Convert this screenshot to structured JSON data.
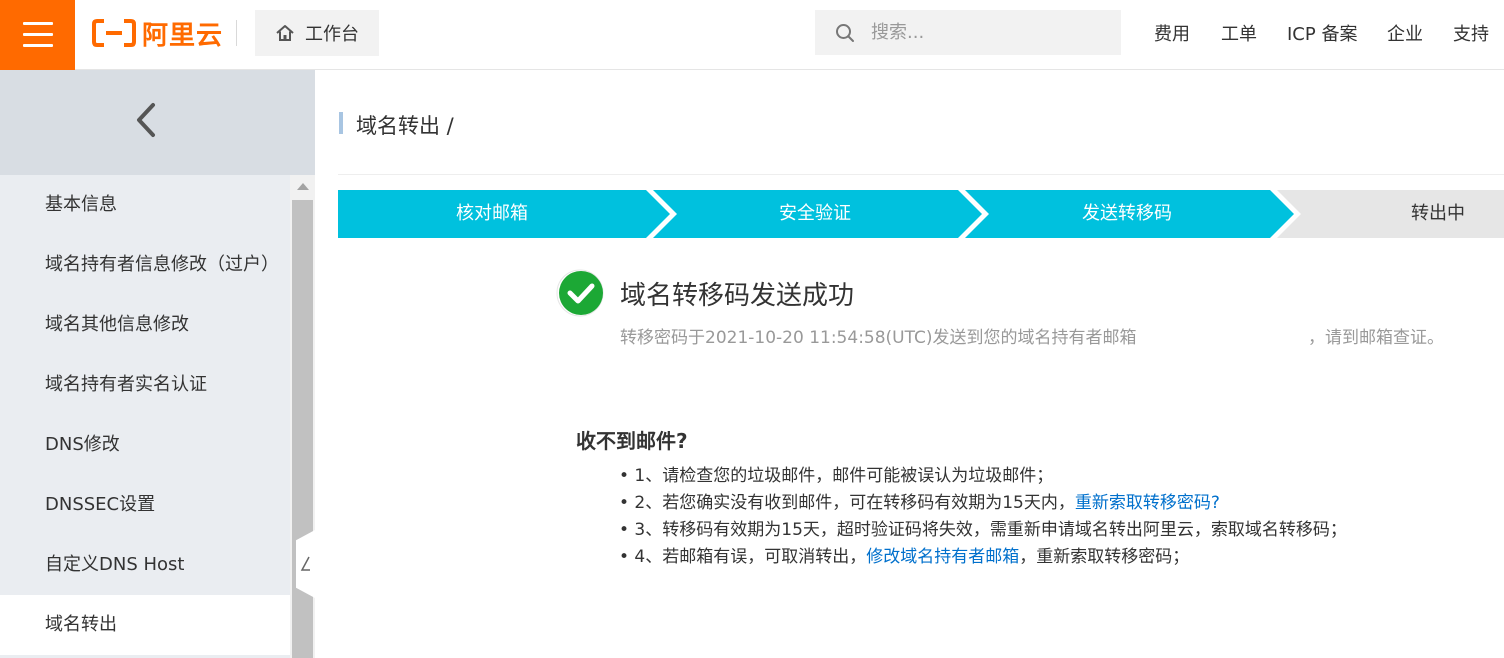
{
  "colors": {
    "brand": "#ff6a00",
    "step_active": "#00c1de",
    "step_inactive": "#e6e6e6",
    "success": "#1ca835",
    "link": "#0070cc"
  },
  "header": {
    "logo_text": "阿里云",
    "workbench_label": "工作台",
    "search_placeholder": "搜索...",
    "nav": [
      "费用",
      "工单",
      "ICP 备案",
      "企业",
      "支持"
    ]
  },
  "sidebar": {
    "items": [
      {
        "label": "基本信息",
        "active": false
      },
      {
        "label": "域名持有者信息修改（过户）",
        "active": false
      },
      {
        "label": "域名其他信息修改",
        "active": false
      },
      {
        "label": "域名持有者实名认证",
        "active": false
      },
      {
        "label": "DNS修改",
        "active": false
      },
      {
        "label": "DNSSEC设置",
        "active": false
      },
      {
        "label": "自定义DNS Host",
        "active": false
      },
      {
        "label": "域名转出",
        "active": true
      }
    ]
  },
  "main": {
    "breadcrumb": "域名转出 /",
    "steps": [
      {
        "label": "核对邮箱",
        "status": "done"
      },
      {
        "label": "安全验证",
        "status": "done"
      },
      {
        "label": "发送转移码",
        "status": "current"
      },
      {
        "label": "转出中",
        "status": "pending"
      }
    ],
    "result": {
      "title": "域名转移码发送成功",
      "desc_prefix": "转移密码于2021-10-20 11:54:58(UTC)发送到您的域名持有者邮箱",
      "desc_suffix": "，请到邮箱查证。"
    },
    "help": {
      "title": "收不到邮件?",
      "items": [
        {
          "text": "• 1、请检查您的垃圾邮件，邮件可能被误认为垃圾邮件；"
        },
        {
          "text": "• 2、若您确实没有收到邮件，可在转移码有效期为15天内，",
          "link": "重新索取转移密码?",
          "suffix": ""
        },
        {
          "text": "• 3、转移码有效期为15天，超时验证码将失效，需重新申请域名转出阿里云，索取域名转移码；"
        },
        {
          "text": "• 4、若邮箱有误，可取消转出，",
          "link": "修改域名持有者邮箱",
          "suffix": "，重新索取转移密码；"
        }
      ]
    }
  }
}
